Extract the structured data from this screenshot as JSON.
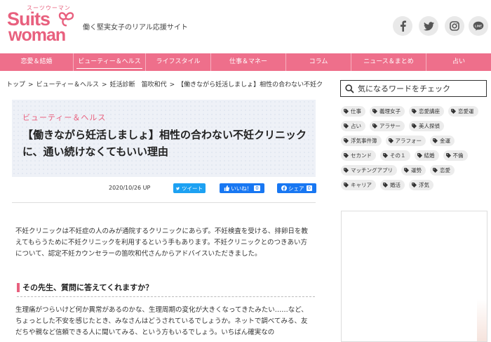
{
  "header": {
    "logo_top": "スーツウーマン",
    "logo_suits": "Suits",
    "logo_woman": "woman",
    "tagline": "働く堅実女子のリアル応援サイト",
    "social": [
      "facebook-icon",
      "twitter-icon",
      "instagram-icon",
      "line-icon"
    ],
    "line_label": "LINE"
  },
  "nav": {
    "items": [
      "恋愛＆結婚",
      "ビューティー＆ヘルス",
      "ライフスタイル",
      "仕事＆マネー",
      "コラム",
      "ニュース＆まとめ",
      "占い"
    ],
    "active_index": 1
  },
  "breadcrumb": [
    "トップ",
    "ビューティー＆ヘルス",
    "妊活診断　笛吹和代",
    "【働きながら妊活しましょ】相性の合わない不妊クリニ..."
  ],
  "article": {
    "category": "ビューティー＆ヘルス",
    "title": "【働きながら妊活しましょ】相性の合わない不妊クリニックに、通い続けなくてもいい理由",
    "date": "2020/10/26 UP",
    "tweet_label": "ツイート",
    "like_label": "いいね！",
    "like_count": "0",
    "share_label": "シェア",
    "share_count": "0",
    "paragraph1": "不妊クリニックは不妊症の人のみが通院するクリニックにあらず。不妊検査を受ける、排卵日を教えてもらうために不妊クリニックを利用するという手もあります。不妊クリニックとのつきあい方について、認定不妊カウンセラーの笛吹和代さんからアドバイスいただきました。",
    "section_title": "その先生、質問に答えてくれますか？",
    "paragraph2": "生理痛がつらいけど何か異常があるのかな、生理周期の変化が大きくなってきたみたい……など、ちょっとした不安を感じたとき、みなさんはどうされているでしょうか。ネットで調べてみる、友だちや親など信頼できる人に聞いてみる、という方もいるでしょう。いちばん確実なの"
  },
  "sidebar": {
    "search_placeholder": "気になるワードをチェック",
    "tags": [
      "仕事",
      "義理女子",
      "恋愛講座",
      "恋愛運",
      "占い",
      "アラサー",
      "美人探偵",
      "浮気事件簿",
      "アラフォー",
      "金運",
      "セカンド",
      "その１",
      "結婚",
      "不倫",
      "マッチングアプリ",
      "運勢",
      "恋愛",
      "キャリア",
      "婚活",
      "浮気"
    ]
  },
  "colors": {
    "brand_pink": "#ee6f8b",
    "twitter_blue": "#1da1f2",
    "facebook_blue": "#1877f2"
  }
}
